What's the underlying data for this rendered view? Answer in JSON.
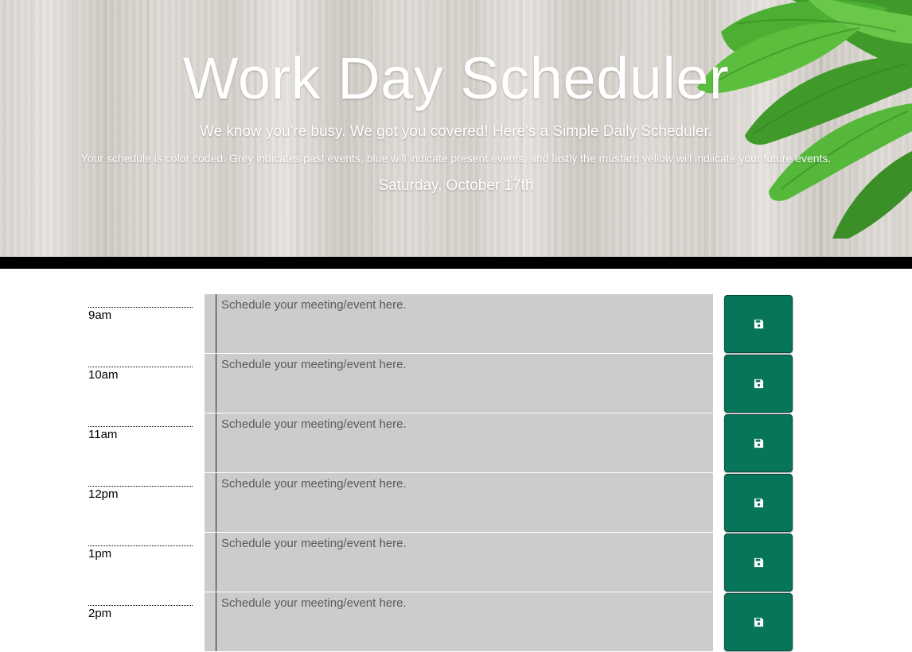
{
  "header": {
    "title": "Work Day Scheduler",
    "lead": "We know you're busy. We got you covered! Here's a Simple Daily Scheduler.",
    "note": "Your schedule is color coded. Grey indicates past events, blue will indicate present events, and lastly the mustard yellow will indiicate your future events.",
    "current_day": "Saturday, October 17th"
  },
  "colors": {
    "past": "#cccccc",
    "save_button": "#06755a",
    "bar": "#000000"
  },
  "schedule": {
    "placeholder": "Schedule your meeting/event here.",
    "save_icon": "floppy-disk-icon",
    "hours": [
      {
        "label": "9am",
        "status": "past",
        "value": ""
      },
      {
        "label": "10am",
        "status": "past",
        "value": ""
      },
      {
        "label": "11am",
        "status": "past",
        "value": ""
      },
      {
        "label": "12pm",
        "status": "past",
        "value": ""
      },
      {
        "label": "1pm",
        "status": "past",
        "value": ""
      },
      {
        "label": "2pm",
        "status": "past",
        "value": ""
      }
    ]
  }
}
